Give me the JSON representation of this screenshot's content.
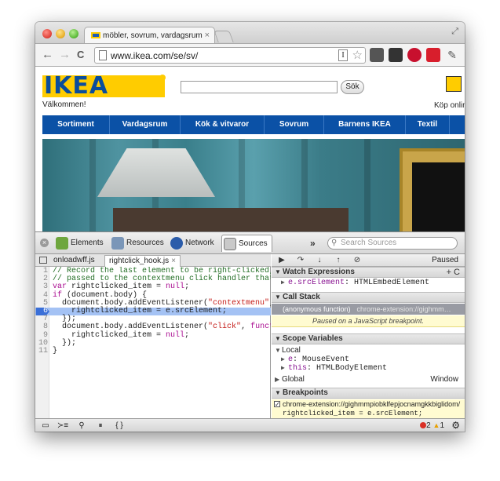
{
  "browser": {
    "tab_title": "möbler, sovrum, vardagsrum",
    "tab_close": "×",
    "url": "www.ikea.com/se/sv/",
    "back": "←",
    "forward": "→",
    "reload": "C",
    "reader": "I",
    "star": "☆",
    "fullscreen": "⤢"
  },
  "page": {
    "logo": "IKEA",
    "welcome": "Välkommen!",
    "search_button": "Sök",
    "cart_text": "Köp onlin",
    "menu": [
      "Sortiment",
      "Vardagsrum",
      "Kök & vitvaror",
      "Sovrum",
      "Barnens IKEA",
      "Textil"
    ]
  },
  "devtools": {
    "close": "×",
    "tabs": [
      "Elements",
      "Resources",
      "Network",
      "Sources"
    ],
    "active_tab": "Sources",
    "more": "»",
    "search_placeholder": "Search Sources",
    "search_icon": "⚲",
    "file_tabs": [
      {
        "name": "onloadwff.js",
        "active": false
      },
      {
        "name": "rightclick_hook.js",
        "active": true,
        "close": "×"
      }
    ],
    "code_lines": [
      {
        "n": "1",
        "text": "// Record the last element to be right-clicked, si",
        "kind": "comment"
      },
      {
        "n": "2",
        "text": "// passed to the contextmenu click handler that ca",
        "kind": "comment"
      },
      {
        "n": "3",
        "text": "var rightclicked_item = null;",
        "kind": "code"
      },
      {
        "n": "4",
        "text": "if (document.body) {",
        "kind": "code"
      },
      {
        "n": "5",
        "text": "  document.body.addEventListener(\"contextmenu\", fu",
        "kind": "code"
      },
      {
        "n": "6",
        "text": "    rightclicked_item = e.srcElement;",
        "kind": "highlight"
      },
      {
        "n": "7",
        "text": "  });",
        "kind": "code"
      },
      {
        "n": "8",
        "text": "  document.body.addEventListener(\"click\", function",
        "kind": "code"
      },
      {
        "n": "9",
        "text": "    rightclicked_item = null;",
        "kind": "code"
      },
      {
        "n": "10",
        "text": "  });",
        "kind": "code"
      },
      {
        "n": "11",
        "text": "}",
        "kind": "code"
      }
    ],
    "debugger": {
      "paused_label": "Paused",
      "buttons": [
        "▶",
        "↷",
        "↓",
        "↑",
        "⊘"
      ]
    },
    "watch": {
      "title": "Watch Expressions",
      "actions": "+  C",
      "items": [
        {
          "expr": "e.srcElement",
          "value": ": HTMLEmbedElement"
        }
      ]
    },
    "call_stack": {
      "title": "Call Stack",
      "frame": "(anonymous function)",
      "frame_source": "chrome-extension://gighmm…",
      "paused_message": "Paused on a JavaScript breakpoint."
    },
    "scope": {
      "title": "Scope Variables",
      "local_label": "Local",
      "local_items": [
        {
          "name": "e",
          "value": ": MouseEvent"
        },
        {
          "name": "this",
          "value": ": HTMLBodyElement"
        }
      ],
      "global_label": "Global",
      "global_value": "Window"
    },
    "breakpoints": {
      "title": "Breakpoints",
      "items": [
        {
          "url": "chrome-extension://gighmmpiobklfepjocnamgkkbiglidom/",
          "code": "rightclicked_item = e.srcElement;"
        }
      ]
    },
    "status": {
      "errors": "2",
      "warnings": "1",
      "buttons": [
        "▭",
        "≻≡",
        "⚲",
        "⏸",
        "{ }"
      ]
    }
  },
  "colors": {
    "ikea_blue": "#0b51a6",
    "ikea_yellow": "#ffcc00",
    "highlight": "#a4c2f4",
    "paused_bg": "#fffbd1"
  }
}
